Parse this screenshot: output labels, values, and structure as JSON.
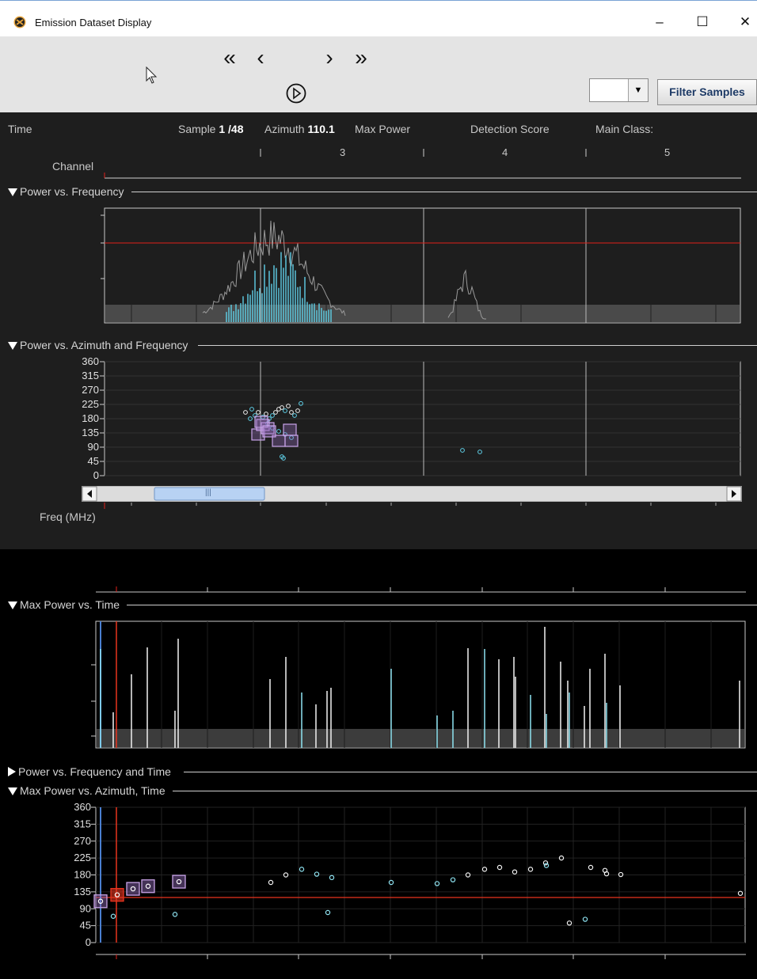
{
  "window": {
    "title": "Emission Dataset Display",
    "minimize": "–",
    "maximize": "☐",
    "close": "✕"
  },
  "toolbar": {
    "nav": {
      "first": "«",
      "prev": "‹",
      "play": "▷",
      "next": "›",
      "last": "»"
    },
    "combo_value": "",
    "filter_label": "Filter Samples"
  },
  "header": {
    "time_label": "Time",
    "sample_prefix": "Sample",
    "sample_value": "1 /48",
    "azimuth_prefix": "Azimuth",
    "azimuth_value": "110.1",
    "max_power": "Max Power",
    "detection_score": "Detection Score",
    "main_class": "Main Class:",
    "channel_label": "Channel",
    "channels": [
      "3",
      "4",
      "5"
    ]
  },
  "sections": {
    "power_freq": "Power vs. Frequency",
    "power_az_freq": "Power vs. Azimuth and Frequency",
    "max_power_time": "Max Power vs. Time",
    "power_freq_time": "Power vs. Frequency and Time",
    "max_power_az_time": "Max Power vs. Azimuth, Time"
  },
  "freq_label": "Freq (MHz)",
  "azimuth_ticks": [
    "360",
    "315",
    "270",
    "225",
    "180",
    "135",
    "90",
    "45",
    "0"
  ],
  "scroll_thumb_glyph": "|||",
  "colors": {
    "accent_cyan": "#5fd0e8",
    "highlight_purple": "#c9a3e8",
    "threshold_red": "#e0201a",
    "selected_red": "#e8341e"
  }
}
